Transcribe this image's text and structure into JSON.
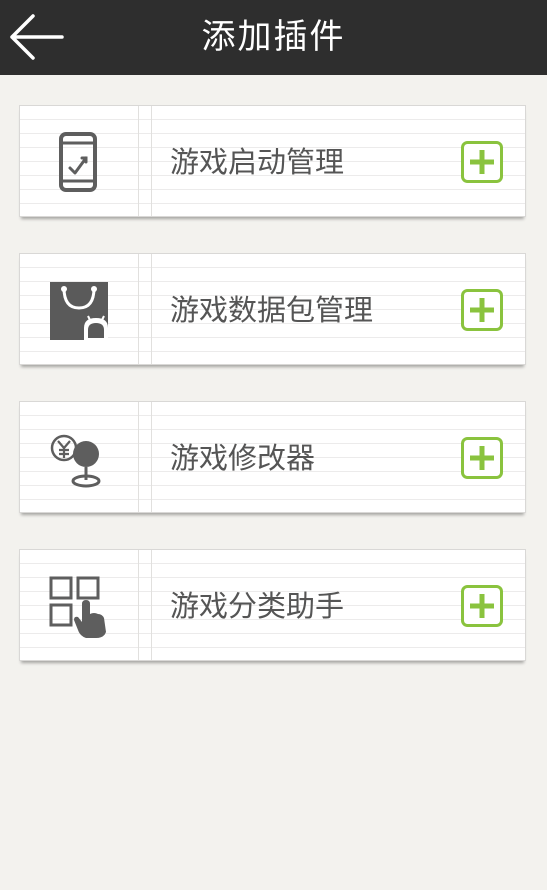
{
  "header": {
    "title": "添加插件",
    "back_icon": "arrow-left-icon"
  },
  "colors": {
    "topbar": "#2e2e2e",
    "accent_green": "#8ac33e",
    "icon_gray": "#5e5e5e",
    "text": "#555555"
  },
  "plugins": [
    {
      "label": "游戏启动管理",
      "icon": "phone-launch-icon",
      "action_icon": "plus-icon"
    },
    {
      "label": "游戏数据包管理",
      "icon": "package-bag-icon",
      "action_icon": "plus-icon"
    },
    {
      "label": "游戏修改器",
      "icon": "game-modifier-icon",
      "action_icon": "plus-icon"
    },
    {
      "label": "游戏分类助手",
      "icon": "category-grid-icon",
      "action_icon": "plus-icon"
    }
  ]
}
